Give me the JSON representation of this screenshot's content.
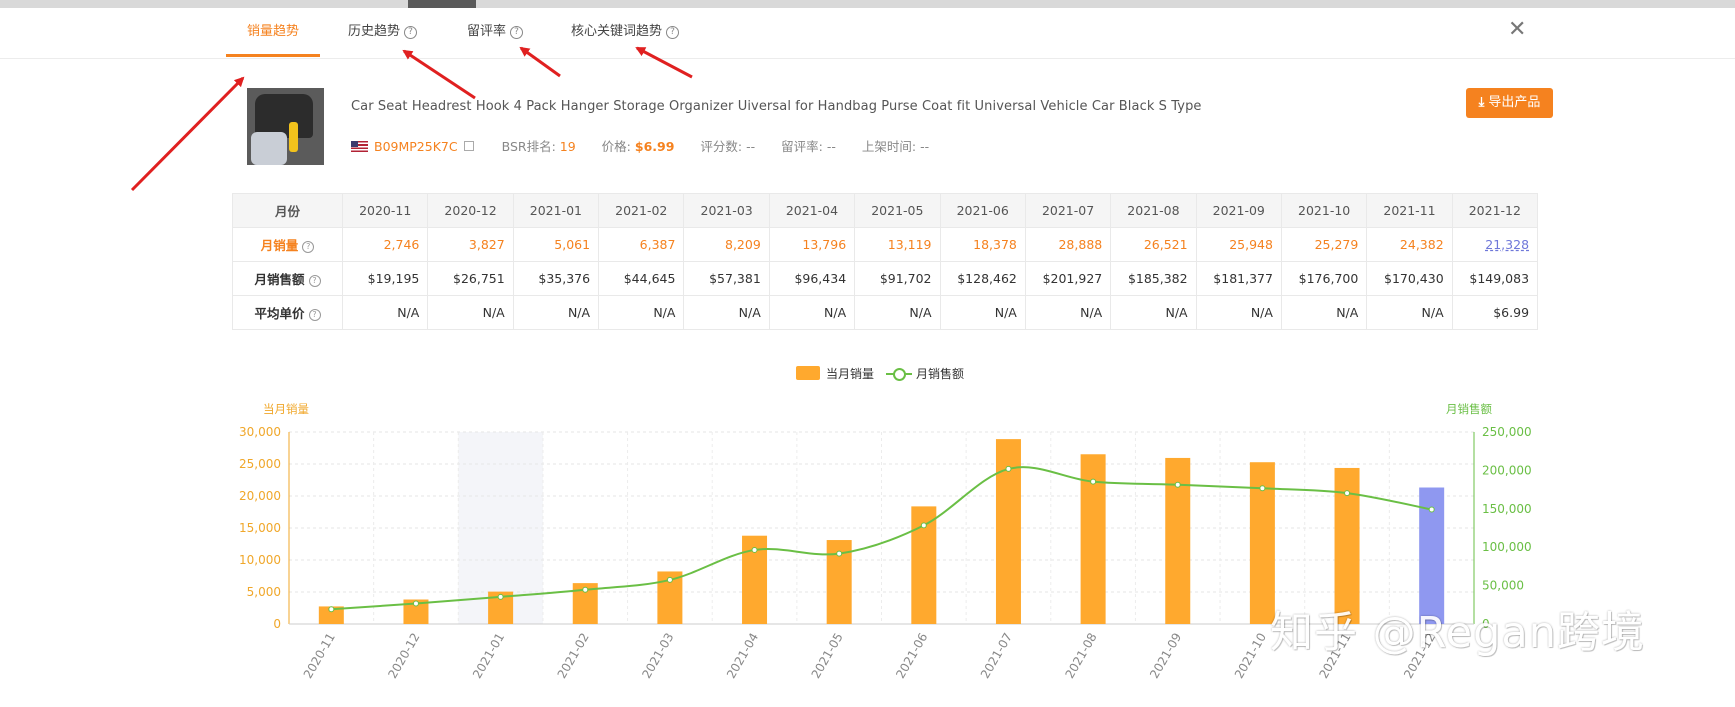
{
  "tabs": [
    {
      "label": "销量趋势",
      "active": true,
      "has_help": false
    },
    {
      "label": "历史趋势",
      "active": false,
      "has_help": true
    },
    {
      "label": "留评率",
      "active": false,
      "has_help": true
    },
    {
      "label": "核心关键词趋势",
      "active": false,
      "has_help": true
    }
  ],
  "help_glyph": "?",
  "close_glyph": "✕",
  "product": {
    "title": "Car Seat Headrest Hook 4 Pack Hanger Storage Organizer Uiversal for Handbag Purse Coat fit Universal Vehicle Car Black S Type",
    "asin": "B09MP25K7C",
    "bsr_label": "BSR排名:",
    "bsr_value": "19",
    "price_label": "价格:",
    "price_value": "$6.99",
    "rating_label": "评分数:",
    "rating_value": "--",
    "review_rate_label": "留评率:",
    "review_rate_value": "--",
    "launch_label": "上架时间:",
    "launch_value": "--"
  },
  "export_button": {
    "label": "导出产品",
    "icon": "download-icon",
    "color": "#f5821f"
  },
  "table": {
    "header_label": "月份",
    "months": [
      "2020-11",
      "2020-12",
      "2021-01",
      "2021-02",
      "2021-03",
      "2021-04",
      "2021-05",
      "2021-06",
      "2021-07",
      "2021-08",
      "2021-09",
      "2021-10",
      "2021-11",
      "2021-12"
    ],
    "rows": [
      {
        "label": "月销量",
        "values": [
          "2,746",
          "3,827",
          "5,061",
          "6,387",
          "8,209",
          "13,796",
          "13,119",
          "18,378",
          "28,888",
          "26,521",
          "25,948",
          "25,279",
          "24,382",
          "21,328"
        ]
      },
      {
        "label": "月销售额",
        "values": [
          "$19,195",
          "$26,751",
          "$35,376",
          "$44,645",
          "$57,381",
          "$96,434",
          "$91,702",
          "$128,462",
          "$201,927",
          "$185,382",
          "$181,377",
          "$176,700",
          "$170,430",
          "$149,083"
        ]
      },
      {
        "label": "平均单价",
        "values": [
          "N/A",
          "N/A",
          "N/A",
          "N/A",
          "N/A",
          "N/A",
          "N/A",
          "N/A",
          "N/A",
          "N/A",
          "N/A",
          "N/A",
          "N/A",
          "$6.99"
        ]
      }
    ]
  },
  "legend": {
    "bar_label": "当月销量",
    "line_label": "月销售额"
  },
  "chart_data": {
    "type": "bar",
    "categories": [
      "2020-11",
      "2020-12",
      "2021-01",
      "2021-02",
      "2021-03",
      "2021-04",
      "2021-05",
      "2021-06",
      "2021-07",
      "2021-08",
      "2021-09",
      "2021-10",
      "2021-11",
      "2021-12"
    ],
    "series": [
      {
        "name": "当月销量",
        "type": "bar",
        "axis": "left",
        "values": [
          2746,
          3827,
          5061,
          6387,
          8209,
          13796,
          13119,
          18378,
          28888,
          26521,
          25948,
          25279,
          24382,
          21328
        ]
      },
      {
        "name": "月销售额",
        "type": "line",
        "axis": "right",
        "values": [
          19195,
          26751,
          35376,
          44645,
          57381,
          96434,
          91702,
          128462,
          201927,
          185382,
          181377,
          176700,
          170430,
          149083
        ]
      }
    ],
    "ylabel": "当月销量",
    "y2label": "月销售额",
    "ylim": [
      0,
      30000
    ],
    "y2lim": [
      0,
      250000
    ],
    "yticks": [
      "0",
      "5,000",
      "10,000",
      "15,000",
      "20,000",
      "25,000",
      "30,000"
    ],
    "y2ticks": [
      "0",
      "50,000",
      "100,000",
      "150,000",
      "200,000",
      "250,000"
    ],
    "highlighted_category": "2021-01",
    "selected_bar_category": "2021-12",
    "grid": true,
    "legend_position": "top-center",
    "colors": {
      "bar": "#ffa92e",
      "bar_selected": "#8f98f0",
      "line": "#6abf45",
      "left_axis": "#f0a72a",
      "right_axis": "#6abf45",
      "highlight_band": "#f4f5f9"
    }
  },
  "watermark": "知乎 @Regan跨境"
}
